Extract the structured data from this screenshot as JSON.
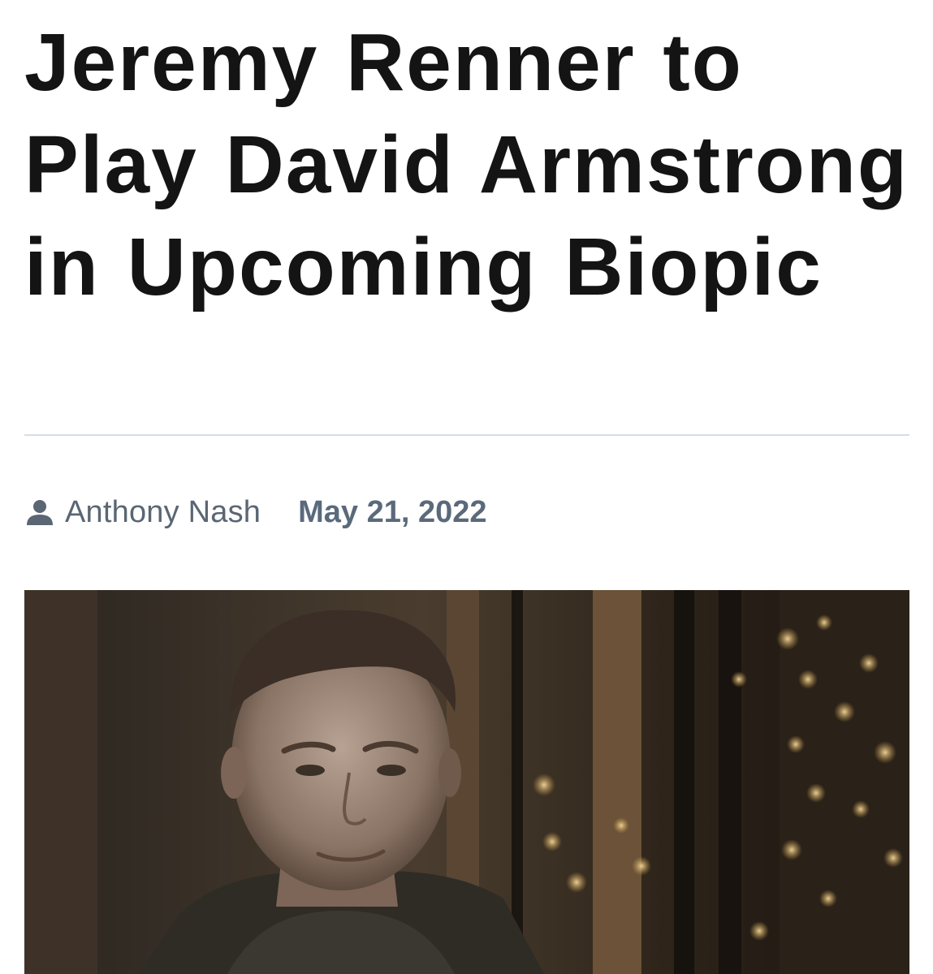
{
  "article": {
    "headline": "Jeremy Renner to Play David Armstrong in Upcoming Biopic",
    "author": "Anthony Nash",
    "date": "May 21, 2022",
    "hero_image_alt": "Jeremy Renner"
  },
  "icons": {
    "author": "user-icon"
  },
  "colors": {
    "headline": "#141414",
    "meta_text": "#5a6673",
    "divider": "#d6dde4"
  }
}
